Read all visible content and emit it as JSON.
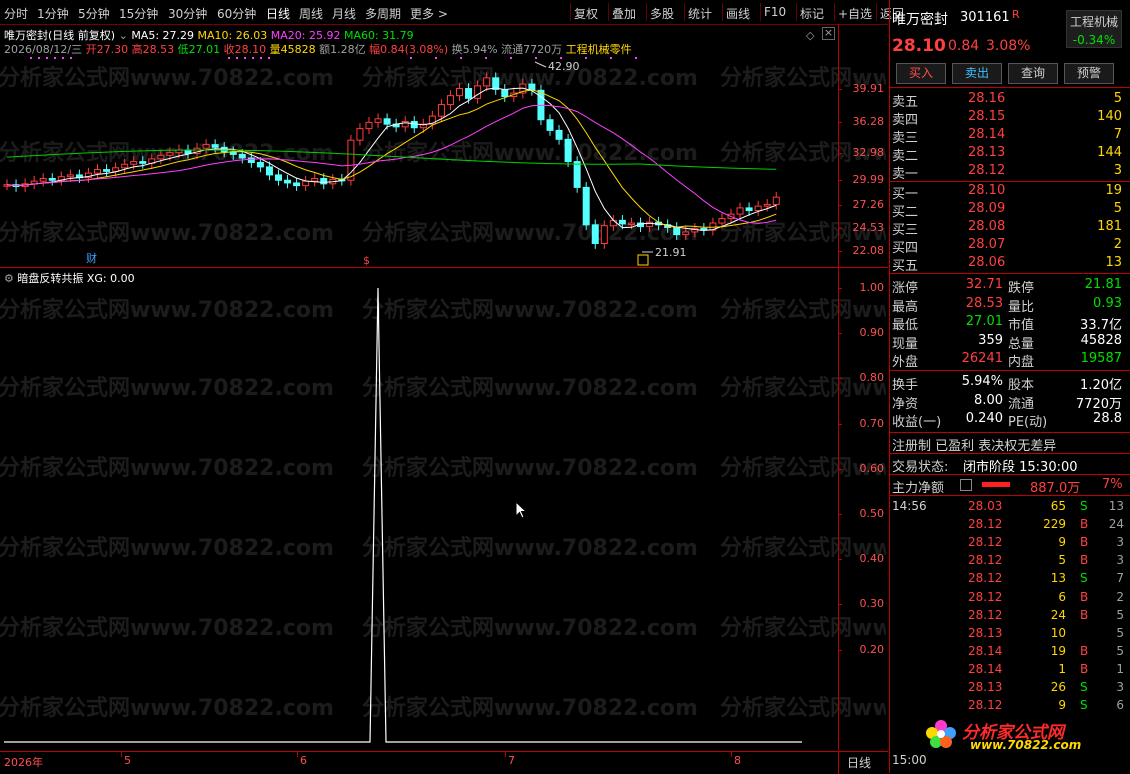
{
  "toolbar": {
    "left_items": [
      "分时",
      "1分钟",
      "5分钟",
      "15分钟",
      "30分钟",
      "60分钟",
      "日线",
      "周线",
      "月线",
      "多周期",
      "更多 >"
    ],
    "right_items": [
      "复权",
      "叠加",
      "多股",
      "统计",
      "画线",
      "F10",
      "标记",
      "+自选",
      "返回"
    ]
  },
  "chart_header": {
    "title": "唯万密封(日线 前复权)",
    "ma5": "MA5: 27.29",
    "ma10": "MA10: 26.03",
    "ma20": "MA20: 25.92",
    "ma60": "MA60: 31.79",
    "date": "2026/08/12/三",
    "open": "开27.30",
    "high": "高28.53",
    "low": "低27.01",
    "close": "收28.10",
    "vol": "量45828",
    "amount": "额1.28亿",
    "amp": "幅0.84(3.08%)",
    "turnover": "换5.94%",
    "float": "流通7720万",
    "sector": "工程机械零件"
  },
  "main_axis": [
    "39.91",
    "36.28",
    "32.98",
    "29.99",
    "27.26",
    "24.53",
    "22.08"
  ],
  "annotations": {
    "high": "42.90",
    "low": "21.91",
    "fin": "财",
    "s": "$"
  },
  "sub_header": {
    "title": "暗盘反转共振",
    "xg": "XG: 0.00"
  },
  "sub_axis": [
    "1.00",
    "0.90",
    "0.80",
    "0.70",
    "0.60",
    "0.50",
    "0.40",
    "0.30",
    "0.20"
  ],
  "x_axis": {
    "labels": [
      "2026年",
      "5",
      "6",
      "7",
      "8"
    ],
    "period": "日线"
  },
  "watermark": "分析家公式网www.70822.com",
  "quote": {
    "name": "唯万密封",
    "code": "301161",
    "flag": "R",
    "sector": "工程机械",
    "sector_change": "-0.34%",
    "price": "28.10",
    "change": "0.84",
    "change_pct": "3.08%",
    "buttons": [
      "买入",
      "卖出",
      "查询",
      "预警"
    ]
  },
  "asks": [
    {
      "label": "卖五",
      "price": "28.16",
      "vol": "5"
    },
    {
      "label": "卖四",
      "price": "28.15",
      "vol": "140"
    },
    {
      "label": "卖三",
      "price": "28.14",
      "vol": "7"
    },
    {
      "label": "卖二",
      "price": "28.13",
      "vol": "144"
    },
    {
      "label": "卖一",
      "price": "28.12",
      "vol": "3"
    }
  ],
  "bids": [
    {
      "label": "买一",
      "price": "28.10",
      "vol": "19"
    },
    {
      "label": "买二",
      "price": "28.09",
      "vol": "5"
    },
    {
      "label": "买三",
      "price": "28.08",
      "vol": "181"
    },
    {
      "label": "买四",
      "price": "28.07",
      "vol": "2"
    },
    {
      "label": "买五",
      "price": "28.06",
      "vol": "13"
    }
  ],
  "stats1": [
    {
      "l1": "涨停",
      "v1": "32.71",
      "l2": "跌停",
      "v2": "21.81"
    },
    {
      "l1": "最高",
      "v1": "28.53",
      "l2": "量比",
      "v2": "0.93"
    },
    {
      "l1": "最低",
      "v1": "27.01",
      "l2": "市值",
      "v2": "33.7亿"
    },
    {
      "l1": "现量",
      "v1": "359",
      "l2": "总量",
      "v2": "45828"
    },
    {
      "l1": "外盘",
      "v1": "26241",
      "l2": "内盘",
      "v2": "19587"
    }
  ],
  "stats2": [
    {
      "l1": "换手",
      "v1": "5.94%",
      "l2": "股本",
      "v2": "1.20亿"
    },
    {
      "l1": "净资",
      "v1": "8.00",
      "l2": "流通",
      "v2": "7720万"
    },
    {
      "l1": "收益(一)",
      "v1": "0.240",
      "l2": "PE(动)",
      "v2": "28.8"
    }
  ],
  "reg": "注册制 已盈利 表决权无差异",
  "trade_status": {
    "label": "交易状态:",
    "value": "闭市阶段 15:30:00"
  },
  "main_flow": {
    "label": "主力净额",
    "value": "887.0万",
    "pct": "7%"
  },
  "ticks": [
    {
      "time": "14:56",
      "price": "28.03",
      "vol": "65",
      "bs": "S",
      "n": "13"
    },
    {
      "time": "",
      "price": "28.12",
      "vol": "229",
      "bs": "B",
      "n": "24"
    },
    {
      "time": "",
      "price": "28.12",
      "vol": "9",
      "bs": "B",
      "n": "3"
    },
    {
      "time": "",
      "price": "28.12",
      "vol": "5",
      "bs": "B",
      "n": "3"
    },
    {
      "time": "",
      "price": "28.12",
      "vol": "13",
      "bs": "S",
      "n": "7"
    },
    {
      "time": "",
      "price": "28.12",
      "vol": "6",
      "bs": "B",
      "n": "2"
    },
    {
      "time": "",
      "price": "28.12",
      "vol": "24",
      "bs": "B",
      "n": "5"
    },
    {
      "time": "",
      "price": "28.13",
      "vol": "10",
      "bs": "",
      "n": "5"
    },
    {
      "time": "",
      "price": "28.14",
      "vol": "19",
      "bs": "B",
      "n": "5"
    },
    {
      "time": "",
      "price": "28.14",
      "vol": "1",
      "bs": "B",
      "n": "1"
    },
    {
      "time": "",
      "price": "28.13",
      "vol": "26",
      "bs": "S",
      "n": "3"
    },
    {
      "time": "",
      "price": "28.12",
      "vol": "9",
      "bs": "S",
      "n": "6"
    }
  ],
  "bottom_time": "15:00",
  "logo": {
    "title": "分析家公式网",
    "url": "www.70822.com"
  }
}
